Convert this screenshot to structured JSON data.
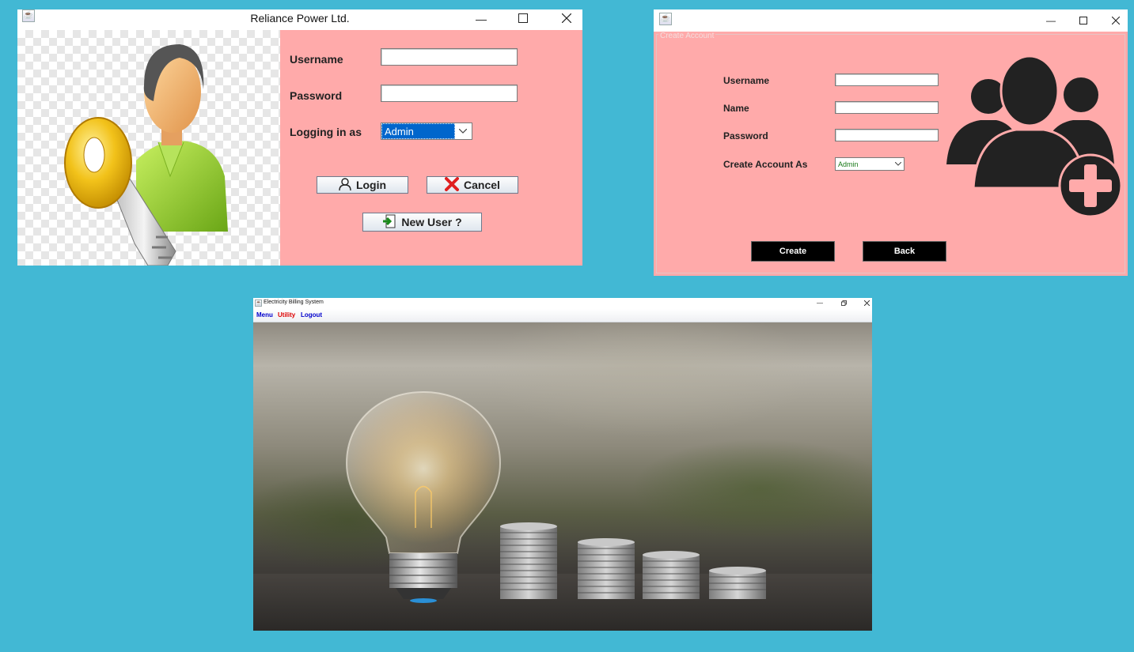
{
  "login_window": {
    "title": "Reliance Power Ltd.",
    "username_label": "Username",
    "password_label": "Password",
    "logging_in_as_label": "Logging in as",
    "logging_in_as_value": "Admin",
    "login_button": "Login",
    "cancel_button": "Cancel",
    "new_user_button": "New User ?"
  },
  "create_window": {
    "title": "",
    "panel_border_title": "Create Account",
    "username_label": "Username",
    "name_label": "Name",
    "password_label": "Password",
    "create_as_label": "Create Account As",
    "create_as_value": "Admin",
    "create_button": "Create",
    "back_button": "Back"
  },
  "main_window": {
    "title": "Electricity Billing System",
    "menu": [
      {
        "label": "Menu",
        "color": "#0000cc"
      },
      {
        "label": "Utility",
        "color": "#dd0000"
      },
      {
        "label": "Logout",
        "color": "#0000cc"
      }
    ]
  },
  "colors": {
    "desktop": "#42b8d4",
    "form_panel": "#ffaaaa",
    "combo_selection": "#0066cc"
  },
  "icons": {
    "login_button_icon": "user-icon",
    "cancel_button_icon": "close-x-icon",
    "new_user_button_icon": "exit-door-icon"
  }
}
